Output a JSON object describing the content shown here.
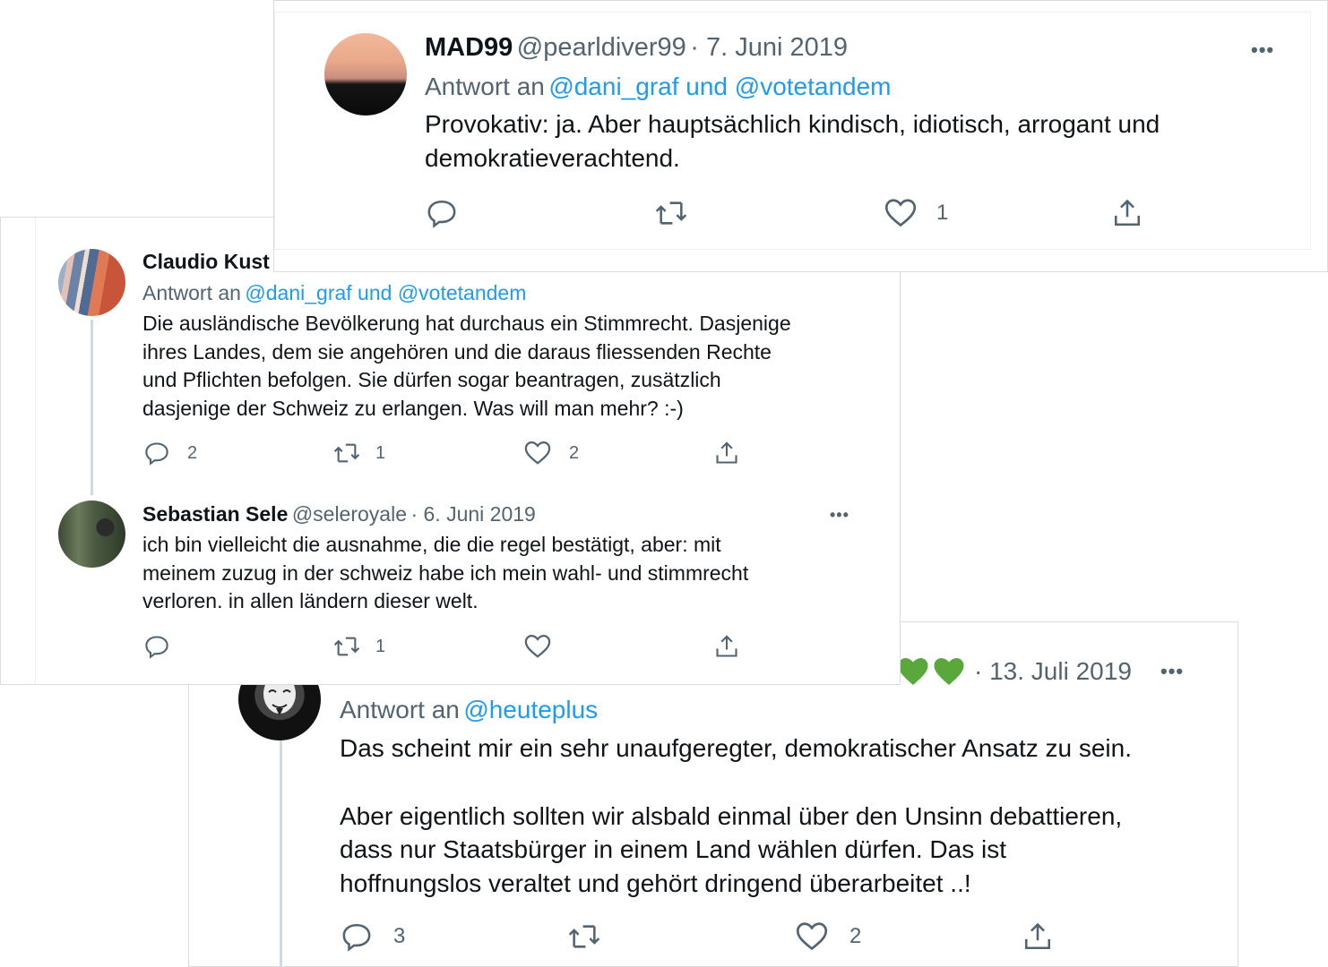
{
  "tweet_mad": {
    "name": "MAD99",
    "handle": "@pearldiver99",
    "date": "· 7. Juni 2019",
    "reply_prefix": "Antwort an",
    "reply_to": "@dani_graf und @votetandem",
    "text_line1": "Provokativ: ja. Aber hauptsächlich kindisch, idiotisch, arrogant und",
    "text_line2": "demokratieverachtend.",
    "likes": "1",
    "more": "•••"
  },
  "tweet_claudio": {
    "name": "Claudio Kust",
    "reply_prefix": "Antwort an",
    "reply_to": "@dani_graf und @votetandem",
    "text_line1": "Die ausländische Bevölkerung hat durchaus ein Stimmrecht. Dasjenige",
    "text_line2": "ihres Landes, dem sie angehören und die daraus fliessenden Rechte",
    "text_line3": "und Pflichten befolgen. Sie dürfen sogar beantragen, zusätzlich",
    "text_line4": "dasjenige der Schweiz zu erlangen. Was will man mehr? :-)",
    "replies": "2",
    "retweets": "1",
    "likes": "2"
  },
  "tweet_sebastian": {
    "name": "Sebastian Sele",
    "handle": "@seleroyale",
    "date": "· 6. Juni 2019",
    "text_line1": "ich bin vielleicht die ausnahme, die die regel bestätigt, aber: mit",
    "text_line2": "meinem zuzug in der schweiz habe ich mein wahl- und stimmrecht",
    "text_line3": "verloren. in allen ländern dieser welt.",
    "retweets": "1",
    "more": "•••"
  },
  "tweet_bottom": {
    "date": "· 13. Juli 2019",
    "reply_prefix": "Antwort an",
    "reply_to": "@heuteplus",
    "text_line1": "Das scheint mir ein sehr unaufgeregter, demokratischer Ansatz zu sein.",
    "text_line2": "Aber eigentlich sollten wir alsbald einmal über den Unsinn debattieren,",
    "text_line3": "dass nur Staatsbürger in einem Land wählen dürfen. Das ist",
    "text_line4": "hoffnungslos veraltet und gehört dringend überarbeitet ..!",
    "replies": "3",
    "likes": "2",
    "more": "•••"
  },
  "colors": {
    "link": "#1d9bf0",
    "muted": "#536471",
    "heart_green": "#5aa83c"
  },
  "icons": [
    "reply-icon",
    "retweet-icon",
    "like-icon",
    "share-icon",
    "more-icon"
  ]
}
